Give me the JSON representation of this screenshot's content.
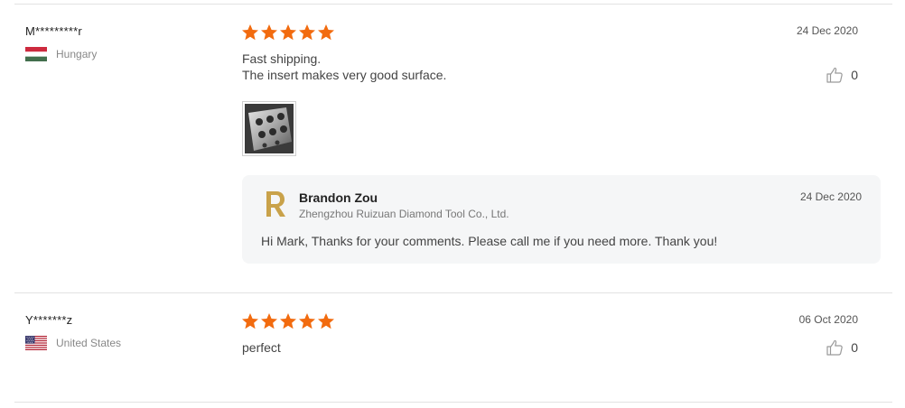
{
  "reviews": [
    {
      "reviewer": "M*********r",
      "country": "Hungary",
      "flag": "flag-hungary",
      "rating": 5,
      "date": "24 Dec 2020",
      "text_lines": [
        "Fast shipping.",
        "The insert makes very good surface."
      ],
      "likes": "0",
      "photo": "engine-block-photo",
      "reply": {
        "name": "Brandon Zou",
        "company": "Zhengzhou Ruizuan Diamond Tool Co., Ltd.",
        "date": "24 Dec 2020",
        "text": "Hi Mark, Thanks for your comments. Please call me if you need more. Thank you!"
      }
    },
    {
      "reviewer": "Y*******z",
      "country": "United States",
      "flag": "flag-united-states",
      "rating": 5,
      "date": "06 Oct 2020",
      "text_lines": [
        "perfect"
      ],
      "likes": "0"
    }
  ],
  "colors": {
    "star": "#f26b0f",
    "divider": "#e2e2e2",
    "reply_bg": "#f5f6f7",
    "logo_gold": "#c9a24a"
  },
  "icons": {
    "star": "star-icon",
    "like": "thumbs-up-icon"
  }
}
